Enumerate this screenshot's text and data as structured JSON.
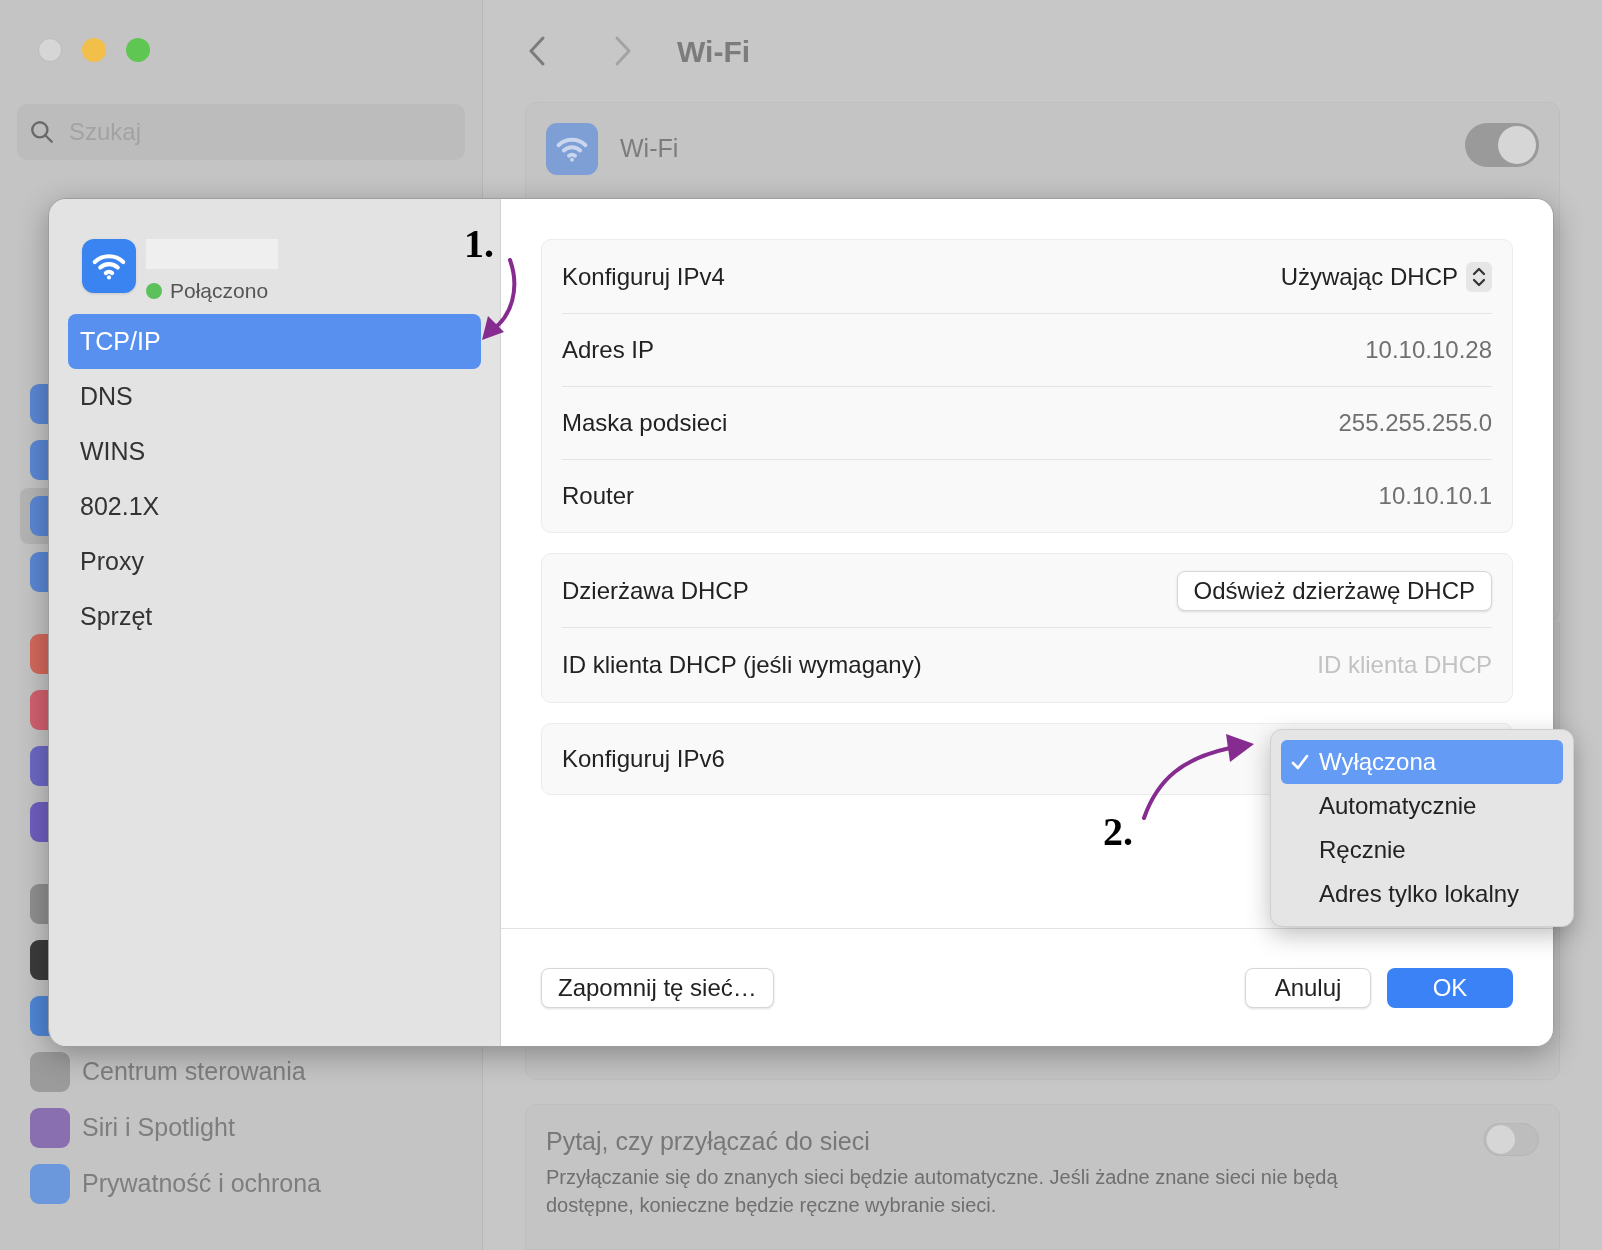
{
  "window": {
    "search": {
      "placeholder": "Szukaj"
    }
  },
  "sidebar": {
    "groups": [
      {
        "items": [
          {
            "color": "#5a87d4",
            "selected": false
          },
          {
            "color": "#5a87d4",
            "selected": false
          },
          {
            "color": "#5a87d4",
            "selected": true
          },
          {
            "color": "#5a87d4",
            "selected": false
          }
        ]
      },
      {
        "items": [
          {
            "color": "#d4685c",
            "selected": false
          },
          {
            "color": "#d2606e",
            "selected": false
          },
          {
            "color": "#6c68c4",
            "selected": false
          },
          {
            "color": "#6f5ec0",
            "selected": false
          }
        ]
      },
      {
        "items": [
          {
            "color": "#8f8f8f",
            "selected": false
          },
          {
            "color": "#3b3b3b",
            "selected": false
          },
          {
            "color": "#4f86d6",
            "selected": false
          },
          {
            "color": "#9b9b9b",
            "selected": false,
            "label": "Centrum sterowania"
          },
          {
            "color": "#8a6fb0",
            "selected": false,
            "label": "Siri i Spotlight"
          },
          {
            "color": "#6b98dc",
            "selected": false,
            "label": "Prywatność i ochrona"
          }
        ]
      }
    ]
  },
  "page": {
    "title": "Wi-Fi",
    "wifi_card": {
      "label": "Wi-Fi",
      "on": true
    },
    "ask_card": {
      "title": "Pytaj, czy przyłączać do sieci",
      "description": "Przyłączanie się do znanych sieci będzie automatyczne. Jeśli żadne znane sieci nie będą dostępne, konieczne będzie ręczne wybranie sieci.",
      "on": false
    }
  },
  "dialog": {
    "network": {
      "status": "Połączono",
      "connected": true
    },
    "tabs": [
      {
        "label": "TCP/IP",
        "selected": true
      },
      {
        "label": "DNS",
        "selected": false
      },
      {
        "label": "WINS",
        "selected": false
      },
      {
        "label": "802.1X",
        "selected": false
      },
      {
        "label": "Proxy",
        "selected": false
      },
      {
        "label": "Sprzęt",
        "selected": false
      }
    ],
    "groups": [
      {
        "rows": [
          {
            "kind": "popup",
            "label": "Konfiguruj IPv4",
            "value": "Używając DHCP"
          },
          {
            "kind": "value",
            "label": "Adres IP",
            "value": "10.10.10.28"
          },
          {
            "kind": "value",
            "label": "Maska podsieci",
            "value": "255.255.255.0"
          },
          {
            "kind": "value",
            "label": "Router",
            "value": "10.10.10.1"
          }
        ]
      },
      {
        "rows": [
          {
            "kind": "button",
            "label": "Dzierżawa DHCP",
            "value": "Odśwież dzierżawę DHCP"
          },
          {
            "kind": "field",
            "label": "ID klienta DHCP (jeśli wymagany)",
            "placeholder": "ID klienta DHCP"
          }
        ]
      },
      {
        "rows": [
          {
            "kind": "menu",
            "label": "Konfiguruj IPv6"
          }
        ]
      }
    ],
    "ipv6_menu": {
      "options": [
        {
          "label": "Wyłączona",
          "selected": true
        },
        {
          "label": "Automatycznie",
          "selected": false
        },
        {
          "label": "Ręcznie",
          "selected": false
        },
        {
          "label": "Adres tylko lokalny",
          "selected": false
        }
      ]
    },
    "buttons": {
      "forget": "Zapomnij tę sieć…",
      "cancel": "Anuluj",
      "ok": "OK"
    }
  },
  "annotations": [
    {
      "label": "1."
    },
    {
      "label": "2."
    }
  ]
}
